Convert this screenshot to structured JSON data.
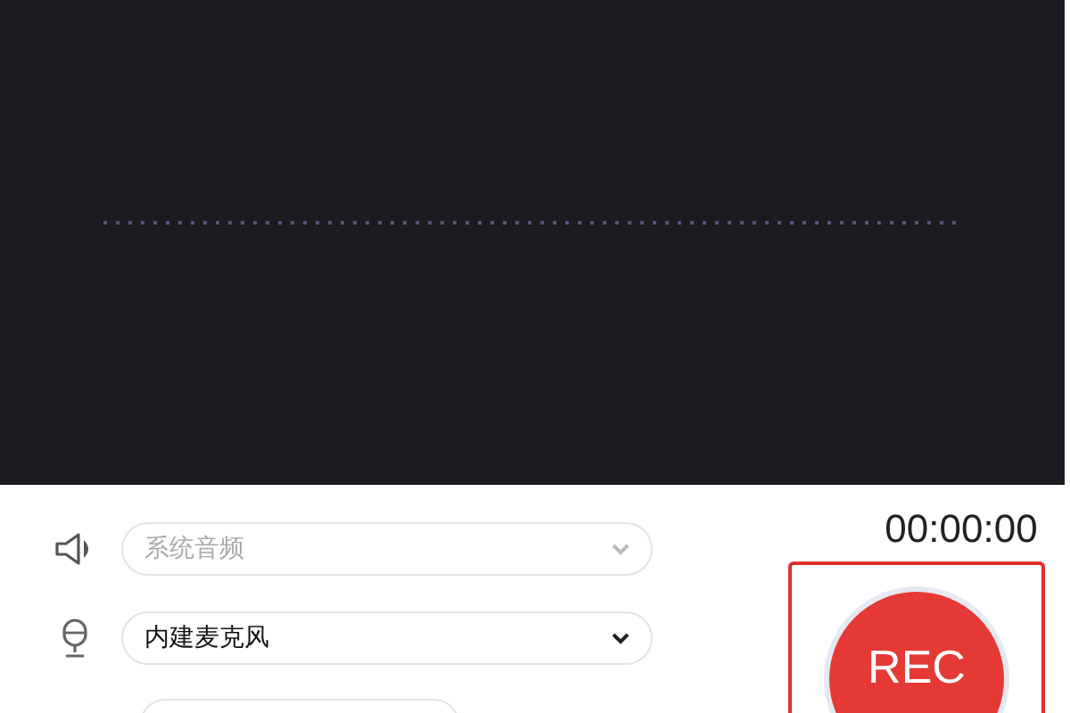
{
  "sources": [
    {
      "kind": "speaker",
      "value": "系统音频",
      "disabled": true
    },
    {
      "kind": "microphone",
      "value": "内建麦克风",
      "disabled": false
    }
  ],
  "timer": "00:00:00",
  "record_button": {
    "label": "REC",
    "selected": true
  }
}
